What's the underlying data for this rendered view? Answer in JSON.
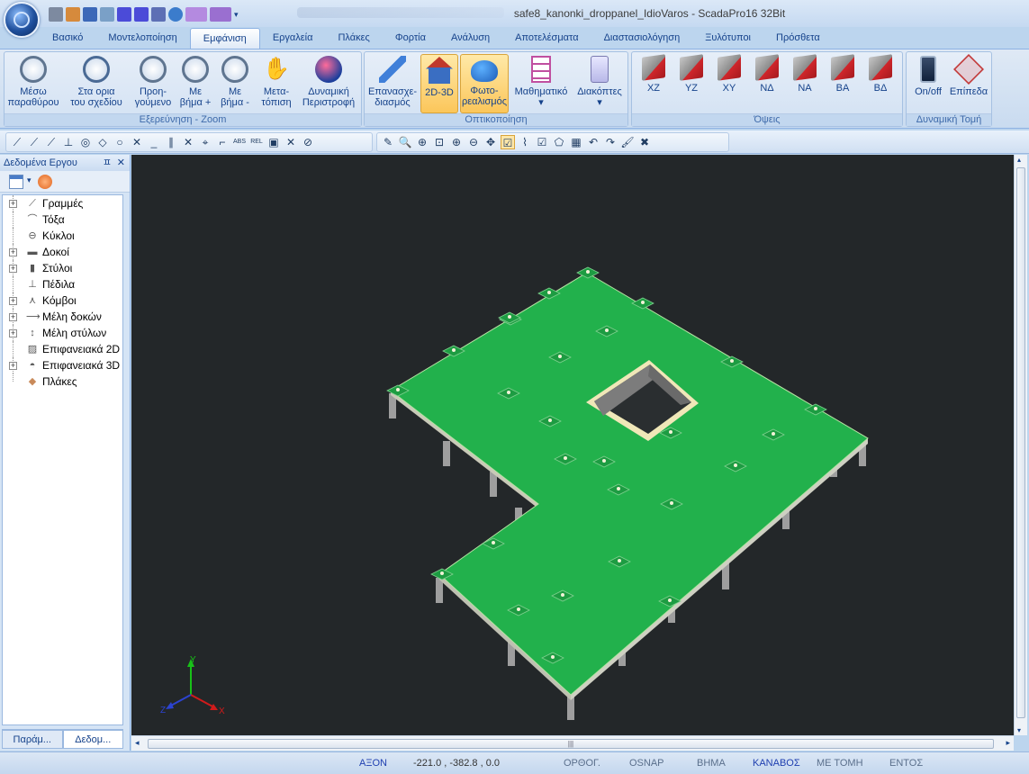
{
  "window": {
    "title": "safe8_kanonki_droppanel_IdioVaros - ScadaPro16 32Bit"
  },
  "ribbon": {
    "tabs": [
      "Βασικό",
      "Μοντελοποίηση",
      "Εμφάνιση",
      "Εργαλεία",
      "Πλάκες",
      "Φορτία",
      "Ανάλυση",
      "Αποτελέσματα",
      "Διαστασιολόγηση",
      "Ξυλότυποι",
      "Πρόσθετα"
    ],
    "active_tab": "Εμφάνιση",
    "zoom_group": {
      "label": "Εξερεύνηση - Zoom",
      "buttons": [
        {
          "line1": "Μέσω",
          "line2": "παραθύρου"
        },
        {
          "line1": "Στα ορια",
          "line2": "του σχεδίου"
        },
        {
          "line1": "Προη-",
          "line2": "γούμενο"
        },
        {
          "line1": "Με",
          "line2": "βήμα +"
        },
        {
          "line1": "Με",
          "line2": "βήμα -"
        },
        {
          "line1": "Μετα-",
          "line2": "τόπιση"
        },
        {
          "line1": "Δυναμική",
          "line2": "Περιστροφή"
        }
      ]
    },
    "vis_group": {
      "label": "Οπτικοποίηση",
      "buttons": [
        {
          "line1": "Επανασχε-",
          "line2": "διασμός"
        },
        {
          "line1": "2D-3D",
          "line2": ""
        },
        {
          "line1": "Φωτο-",
          "line2": "ρεαλισμός"
        },
        {
          "line1": "Μαθηματικό",
          "line2": "▾"
        },
        {
          "line1": "Διακόπτες",
          "line2": "▾"
        }
      ]
    },
    "views_group": {
      "label": "Όψεις",
      "buttons": [
        "XZ",
        "YZ",
        "XY",
        "ΝΔ",
        "ΝΑ",
        "ΒΑ",
        "ΒΔ"
      ]
    },
    "section_group": {
      "label": "Δυναμική Τομή",
      "buttons": [
        "On/off",
        "Επίπεδα"
      ]
    }
  },
  "left_panel": {
    "title": "Δεδομένα Εργου",
    "pin": "ㅍ",
    "close": "✕",
    "tree": [
      {
        "label": "Γραμμές",
        "expandable": true,
        "icon": "line-icon"
      },
      {
        "label": "Τόξα",
        "expandable": false,
        "icon": "arc-icon"
      },
      {
        "label": "Κύκλοι",
        "expandable": false,
        "icon": "circle-icon"
      },
      {
        "label": "Δοκοί",
        "expandable": true,
        "icon": "beam-icon"
      },
      {
        "label": "Στύλοι",
        "expandable": true,
        "icon": "column-icon"
      },
      {
        "label": "Πέδιλα",
        "expandable": false,
        "icon": "footing-icon"
      },
      {
        "label": "Κόμβοι",
        "expandable": true,
        "icon": "node-icon"
      },
      {
        "label": "Μέλη δοκών",
        "expandable": true,
        "icon": "beam-member-icon"
      },
      {
        "label": "Μέλη στύλων",
        "expandable": true,
        "icon": "column-member-icon"
      },
      {
        "label": "Επιφανειακά 2D",
        "expandable": false,
        "icon": "surface-2d-icon"
      },
      {
        "label": "Επιφανειακά 3D",
        "expandable": true,
        "icon": "surface-3d-icon"
      },
      {
        "label": "Πλάκες",
        "expandable": false,
        "icon": "slab-icon"
      }
    ],
    "bottom_tabs": [
      "Παράμ...",
      "Δεδομ..."
    ]
  },
  "viewport": {
    "axis_labels": {
      "x": "X",
      "y": "Y",
      "z": "Z"
    },
    "colors": {
      "background": "#232729",
      "slab": "#22b14c",
      "columns": "#a9a9a9",
      "opening": "#7c7c7c"
    }
  },
  "status_bar": {
    "axon": "ΑΞΟΝ",
    "coords": "-221.0 , -382.8 , 0.0",
    "ortho": "ΟΡΘΟΓ.",
    "osnap": "OSNAP",
    "step": "ΒΗΜΑ",
    "canvas": "ΚΑΝΑΒΟΣ",
    "with_section": "ΜΕ ΤΟΜΗ",
    "inside": "ΕΝΤΟΣ"
  }
}
